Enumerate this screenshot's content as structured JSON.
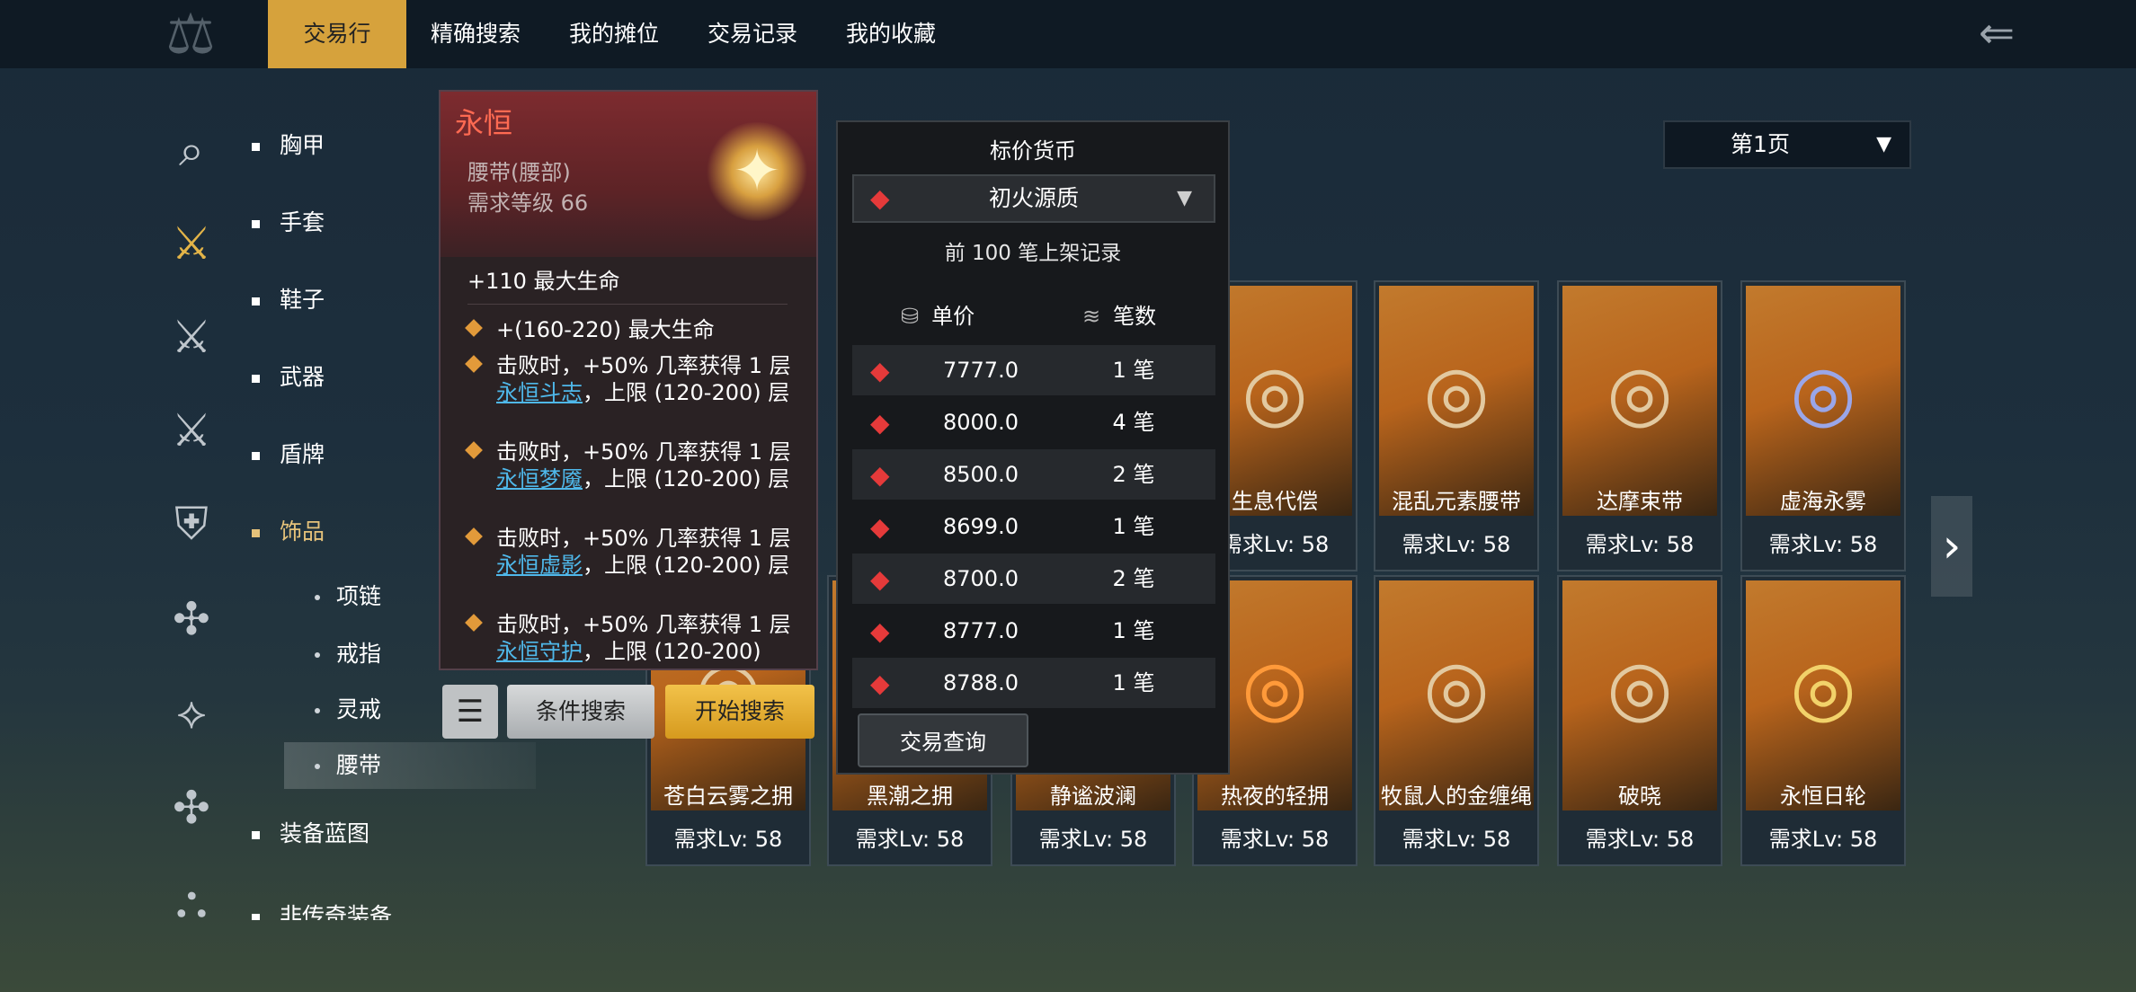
{
  "top_tabs": [
    "交易行",
    "精确搜索",
    "我的摊位",
    "交易记录",
    "我的收藏"
  ],
  "categories": {
    "items": [
      "胸甲",
      "手套",
      "鞋子",
      "武器",
      "盾牌",
      "饰品"
    ],
    "subitems": [
      "项链",
      "戒指",
      "灵戒",
      "腰带"
    ],
    "more": [
      "装备蓝图",
      "非传奇装备"
    ]
  },
  "page_select": {
    "label": "第1页",
    "arrow": "▼"
  },
  "tooltip": {
    "name": "永恒",
    "type": "腰带(腰部)",
    "requirement": "需求等级 66",
    "base_stat": "+110 最大生命",
    "affixes": [
      {
        "text": "+(160-220) 最大生命",
        "link": "",
        "suffix": ""
      },
      {
        "text": "击败时，+50% 几率获得 1 层",
        "link": "永恒斗志",
        "suffix": "，上限 (120-200) 层"
      },
      {
        "text": "击败时，+50% 几率获得 1 层",
        "link": "永恒梦魇",
        "suffix": "，上限 (120-200) 层"
      },
      {
        "text": "击败时，+50% 几率获得 1 层",
        "link": "永恒虚影",
        "suffix": "，上限 (120-200) 层"
      },
      {
        "text": "击败时，+50% 几率获得 1 层",
        "link": "永恒守护",
        "suffix": "，上限 (120-200)"
      }
    ]
  },
  "buttons": {
    "menu": "☰",
    "condition_search": "条件搜索",
    "start_search": "开始搜索"
  },
  "price_panel": {
    "title": "标价货币",
    "currency": "初火源质",
    "records_note": "前 100 笔上架记录",
    "col_unit_price": "单价",
    "col_count": "笔数",
    "rows": [
      {
        "price": "7777.0",
        "count": "1 笔"
      },
      {
        "price": "8000.0",
        "count": "4 笔"
      },
      {
        "price": "8500.0",
        "count": "2 笔"
      },
      {
        "price": "8699.0",
        "count": "1 笔"
      },
      {
        "price": "8700.0",
        "count": "2 笔"
      },
      {
        "price": "8777.0",
        "count": "1 笔"
      },
      {
        "price": "8788.0",
        "count": "1 笔"
      }
    ],
    "query_button": "交易查询"
  },
  "cards_row1": [
    {
      "name": "生息代偿",
      "level": "需求Lv: 58"
    },
    {
      "name": "混乱元素腰带",
      "level": "需求Lv: 58"
    },
    {
      "name": "达摩束带",
      "level": "需求Lv: 58"
    },
    {
      "name": "虚海永雾",
      "level": "需求Lv: 58"
    }
  ],
  "cards_row2": [
    {
      "name": "苍白云雾之拥",
      "level": "需求Lv: 58"
    },
    {
      "name": "黑潮之拥",
      "level": "需求Lv: 58"
    },
    {
      "name": "静谧波澜",
      "level": "需求Lv: 58"
    },
    {
      "name": "热夜的轻拥",
      "level": "需求Lv: 58"
    },
    {
      "name": "牧鼠人的金缠绳",
      "level": "需求Lv: 58"
    },
    {
      "name": "破晓",
      "level": "需求Lv: 58"
    },
    {
      "name": "永恒日轮",
      "level": "需求Lv: 58"
    }
  ],
  "icons": {
    "back": "back-arrow-icon",
    "next": "chevron-right-icon",
    "currency": "red-crystal-icon"
  },
  "colors": {
    "accent": "#d6a23c",
    "tooltip_name": "#ff6a52",
    "link": "#4fb8ea",
    "card_bg": "#c27a2d"
  }
}
